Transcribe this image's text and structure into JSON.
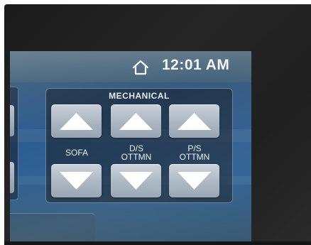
{
  "status_bar": {
    "home_icon": "home-icon",
    "time": "12:01 AM"
  },
  "mechanical": {
    "title": "MECHANICAL",
    "controls": [
      {
        "label_line1": "SOFA",
        "label_line2": "",
        "up_icon": "triangle-up-icon",
        "down_icon": "triangle-down-icon"
      },
      {
        "label_line1": "D/S",
        "label_line2": "OTTMN",
        "up_icon": "triangle-up-icon",
        "down_icon": "triangle-down-icon"
      },
      {
        "label_line1": "P/S",
        "label_line2": "OTTMN",
        "up_icon": "triangle-up-icon",
        "down_icon": "triangle-down-icon"
      }
    ]
  },
  "colors": {
    "screen_blue": "#2e5c8e",
    "button_face": "#b4bfca",
    "arrow_white": "#ffffff",
    "text": "#eef2f5"
  }
}
